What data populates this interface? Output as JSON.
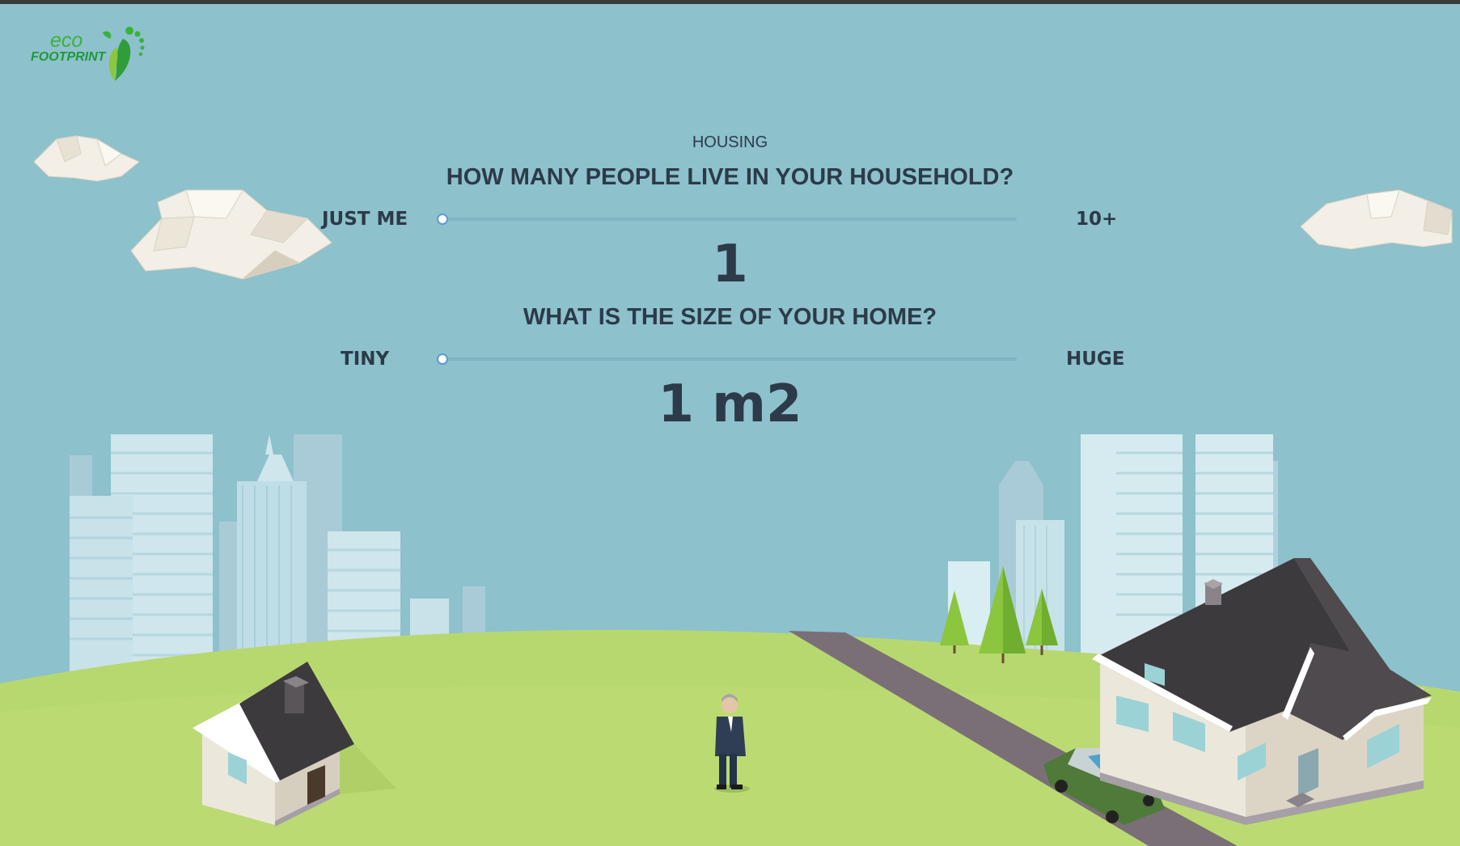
{
  "logo": {
    "line1": "eco",
    "line2": "FOOTPRINT"
  },
  "section": "HOUSING",
  "question1": {
    "title": "HOW MANY PEOPLE LIVE IN YOUR HOUSEHOLD?",
    "min_label": "JUST ME",
    "max_label": "10+",
    "value": "1",
    "slider_fraction": 0
  },
  "question2": {
    "title": "WHAT IS THE SIZE OF YOUR HOME?",
    "min_label": "TINY",
    "max_label": "HUGE",
    "value": "1 m2",
    "slider_fraction": 0
  },
  "colors": {
    "sky": "#8dc1cc",
    "grass": "#b7d86f",
    "text": "#2c3a4a",
    "road": "#7a6f77",
    "roof": "#3d3a3d"
  }
}
